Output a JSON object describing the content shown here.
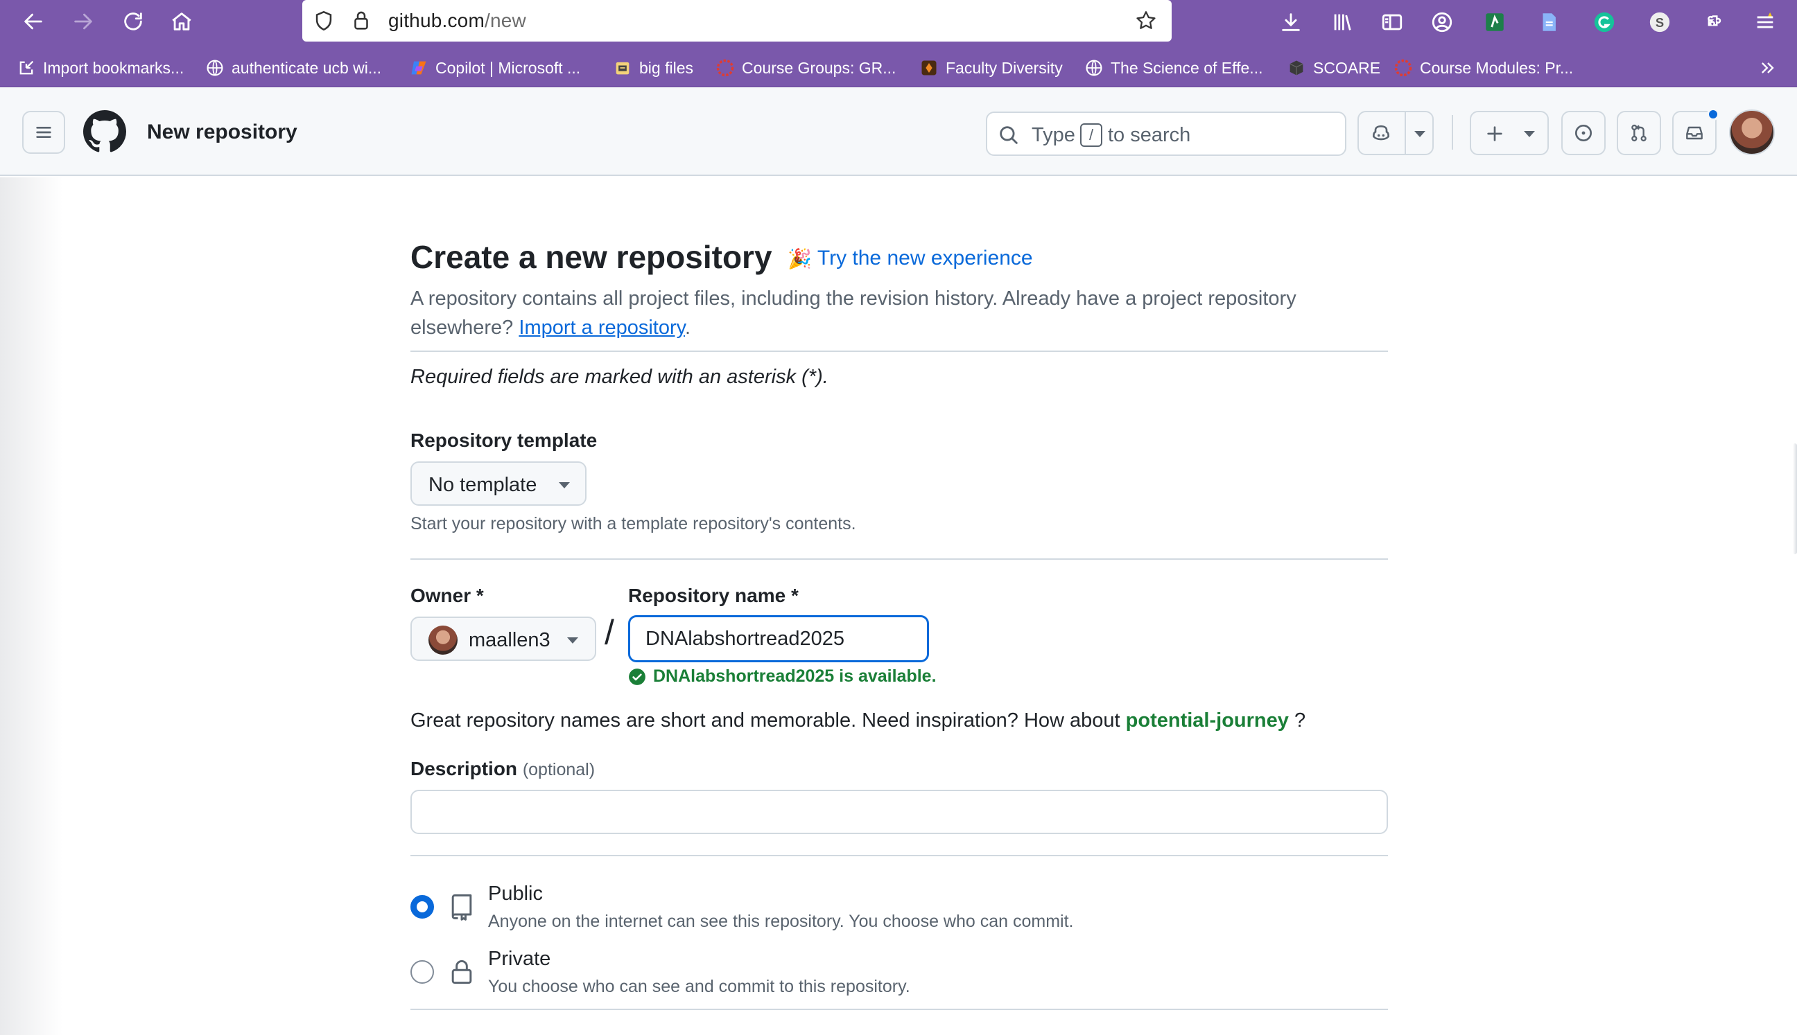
{
  "browser": {
    "url_host": "github.com",
    "url_path": "/new",
    "bookmarks": [
      {
        "label": "Import bookmarks...",
        "icon": "import-icon"
      },
      {
        "label": "authenticate ucb wi...",
        "icon": "globe-icon"
      },
      {
        "label": "Copilot | Microsoft ...",
        "icon": "copilot-icon"
      },
      {
        "label": "big files",
        "icon": "box-icon"
      },
      {
        "label": "Course Groups: GR...",
        "icon": "canvas-icon"
      },
      {
        "label": "Faculty Diversity",
        "icon": "site-icon"
      },
      {
        "label": "The Science of Effe...",
        "icon": "globe-icon"
      },
      {
        "label": "SCOARE",
        "icon": "cube-icon"
      },
      {
        "label": "Course Modules: Pr...",
        "icon": "canvas-icon"
      }
    ]
  },
  "header": {
    "title": "New repository",
    "search_type": "Type",
    "search_key": "/",
    "search_rest": "to search"
  },
  "form": {
    "heading": "Create a new repository",
    "try_new": "Try the new experience",
    "intro_text": "A repository contains all project files, including the revision history. Already have a project repository elsewhere?",
    "import_link": "Import a repository",
    "intro_end": ".",
    "required_note": "Required fields are marked with an asterisk (*).",
    "template_label": "Repository template",
    "template_value": "No template",
    "template_help": "Start your repository with a template repository's contents.",
    "owner_label": "Owner *",
    "owner_value": "maallen3",
    "separator": "/",
    "repo_label": "Repository name *",
    "repo_value": "DNAlabshortread2025",
    "availability": "DNAlabshortread2025 is available.",
    "suggest_prefix": "Great repository names are short and memorable. Need inspiration? How about",
    "suggest_name": "potential-journey",
    "suggest_suffix": "?",
    "description_label": "Description",
    "description_optional": "(optional)",
    "description_value": "",
    "visibility": {
      "selected": "public",
      "public_title": "Public",
      "public_desc": "Anyone on the internet can see this repository. You choose who can commit.",
      "private_title": "Private",
      "private_desc": "You choose who can see and commit to this repository."
    }
  },
  "colors": {
    "browser_chrome": "#7a58ab",
    "link": "#0969da",
    "success": "#1a7f37",
    "border": "#d1d9e0"
  }
}
